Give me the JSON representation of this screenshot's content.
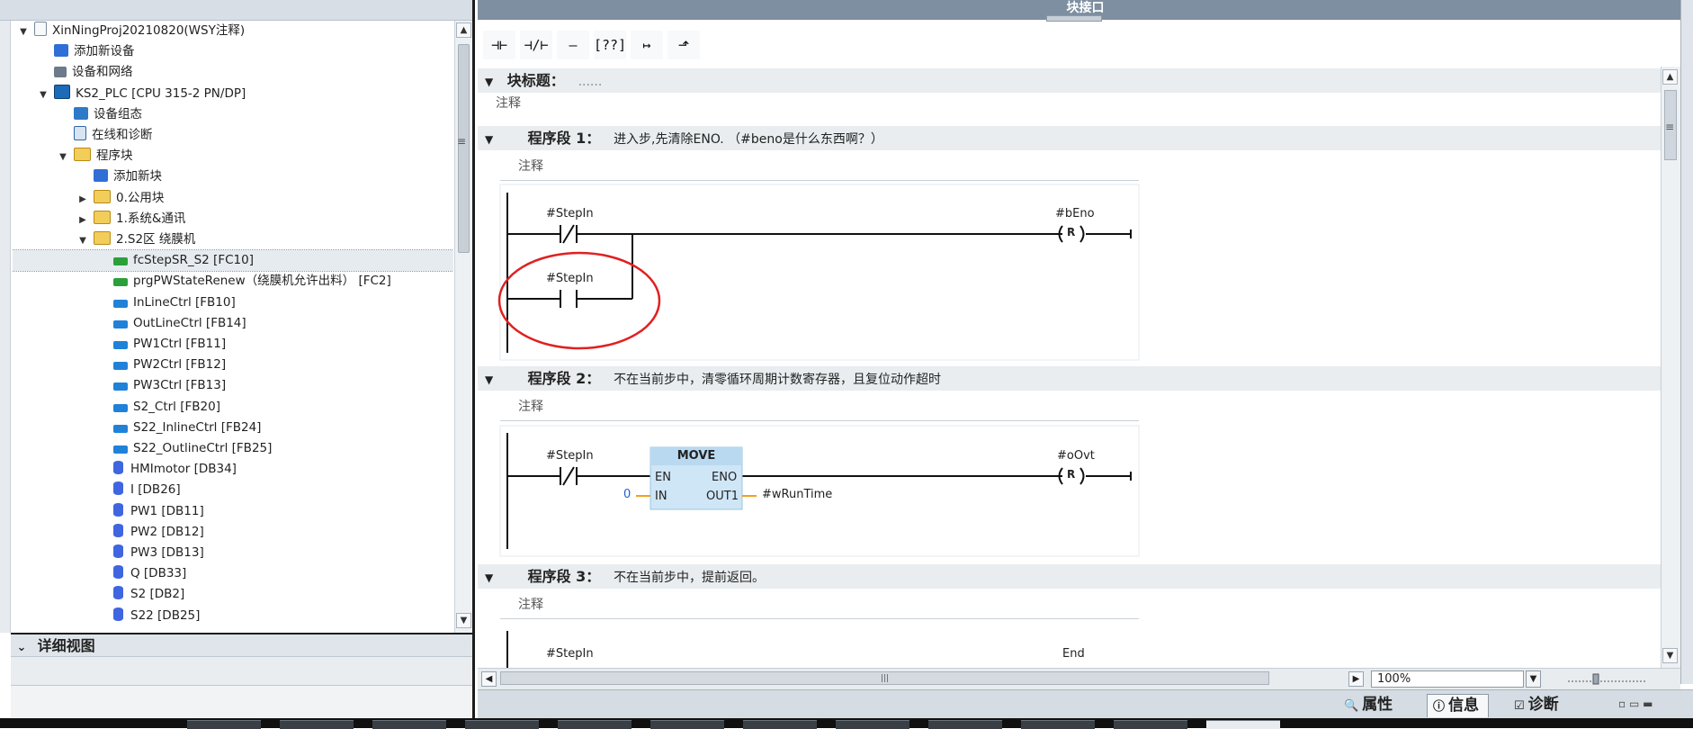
{
  "window": {
    "block_interface_label": "块接口"
  },
  "project_tree": {
    "rows": [
      {
        "label": "XinNingProj20210820(WSY注释)",
        "icon": "project-icon",
        "twisty": "▼"
      },
      {
        "label": "添加新设备",
        "icon": "add-device-icon",
        "twisty": ""
      },
      {
        "label": "设备和网络",
        "icon": "network-icon",
        "twisty": ""
      },
      {
        "label": "KS2_PLC [CPU 315-2 PN/DP]",
        "icon": "plc-icon",
        "twisty": "▼"
      },
      {
        "label": "设备组态",
        "icon": "device-config-icon",
        "twisty": ""
      },
      {
        "label": "在线和诊断",
        "icon": "online-diag-icon",
        "twisty": ""
      },
      {
        "label": "程序块",
        "icon": "folder-icon",
        "twisty": "▼"
      },
      {
        "label": "添加新块",
        "icon": "add-block-icon",
        "twisty": ""
      },
      {
        "label": "0.公用块",
        "icon": "folder-icon",
        "twisty": "▶"
      },
      {
        "label": "1.系统&通讯",
        "icon": "folder-icon",
        "twisty": "▶"
      },
      {
        "label": "2.S2区 绕膜机",
        "icon": "folder-icon",
        "twisty": "▼"
      },
      {
        "label": "fcStepSR_S2 [FC10]",
        "icon": "fc-icon",
        "twisty": ""
      },
      {
        "label": "prgPWStateRenew（绕膜机允许出料） [FC2]",
        "icon": "fc-icon",
        "twisty": ""
      },
      {
        "label": "InLineCtrl [FB10]",
        "icon": "fb-icon",
        "twisty": ""
      },
      {
        "label": "OutLineCtrl [FB14]",
        "icon": "fb-icon",
        "twisty": ""
      },
      {
        "label": "PW1Ctrl [FB11]",
        "icon": "fb-icon",
        "twisty": ""
      },
      {
        "label": "PW2Ctrl [FB12]",
        "icon": "fb-icon",
        "twisty": ""
      },
      {
        "label": "PW3Ctrl [FB13]",
        "icon": "fb-icon",
        "twisty": ""
      },
      {
        "label": "S2_Ctrl [FB20]",
        "icon": "fb-icon",
        "twisty": ""
      },
      {
        "label": "S22_InlineCtrl [FB24]",
        "icon": "fb-icon",
        "twisty": ""
      },
      {
        "label": "S22_OutlineCtrl [FB25]",
        "icon": "fb-icon",
        "twisty": ""
      },
      {
        "label": "HMImotor [DB34]",
        "icon": "db-icon",
        "twisty": ""
      },
      {
        "label": "I [DB26]",
        "icon": "db-icon",
        "twisty": ""
      },
      {
        "label": "PW1 [DB11]",
        "icon": "db-icon",
        "twisty": ""
      },
      {
        "label": "PW2 [DB12]",
        "icon": "db-icon",
        "twisty": ""
      },
      {
        "label": "PW3 [DB13]",
        "icon": "db-icon",
        "twisty": ""
      },
      {
        "label": "Q [DB33]",
        "icon": "db-icon",
        "twisty": ""
      },
      {
        "label": "S2 [DB2]",
        "icon": "db-icon",
        "twisty": ""
      },
      {
        "label": "S22 [DB25]",
        "icon": "db-icon",
        "twisty": ""
      }
    ],
    "selected_index": 11,
    "detail_view_label": "详细视图"
  },
  "toolbar": {
    "buttons": [
      {
        "glyph": "⊣⊢",
        "name": "no-contact-button"
      },
      {
        "glyph": "⊣/⊢",
        "name": "nc-contact-button"
      },
      {
        "glyph": "–()–",
        "name": "coil-button"
      },
      {
        "glyph": "[??]",
        "name": "empty-box-button"
      },
      {
        "glyph": "↦",
        "name": "open-branch-button"
      },
      {
        "glyph": "⬏",
        "name": "close-branch-button"
      }
    ]
  },
  "editor": {
    "block_title_label": "块标题：",
    "block_title_value": "......",
    "block_comment": "注释",
    "networks": [
      {
        "label": "程序段 1：",
        "title": "进入步,先清除ENO. （#beno是什么东西啊？）",
        "comment": "注释",
        "contact_var": "#StepIn",
        "branch_var": "#StepIn",
        "coil_var": "#bEno",
        "coil_type": "R"
      },
      {
        "label": "程序段 2：",
        "title": "不在当前步中，清零循环周期计数寄存器，且复位动作超时",
        "comment": "注释",
        "contact_var": "#StepIn",
        "box_name": "MOVE",
        "en": "EN",
        "eno": "ENO",
        "in": "IN",
        "out": "OUT1",
        "in_value": "0",
        "out_var": "#wRunTime",
        "coil_var": "#oOvt",
        "coil_type": "R"
      },
      {
        "label": "程序段 3：",
        "title": "不在当前步中，提前返回。",
        "comment": "注释",
        "contact_var": "#StepIn",
        "end_label": "End"
      }
    ]
  },
  "status": {
    "zoom": "100%",
    "tabs": [
      {
        "label": "属性",
        "icon": "properties-icon"
      },
      {
        "label": "信息",
        "icon": "info-icon"
      },
      {
        "label": "诊断",
        "icon": "diagnostics-icon"
      }
    ],
    "active_tab": 1
  },
  "colors": {
    "header_bar": "#7d8fa0",
    "section_bg": "#e9edf0",
    "box_fill": "#cfe6f7",
    "highlight_circle": "#e02020",
    "wire_orange": "#f0a020",
    "value_blue": "#2060d0"
  }
}
